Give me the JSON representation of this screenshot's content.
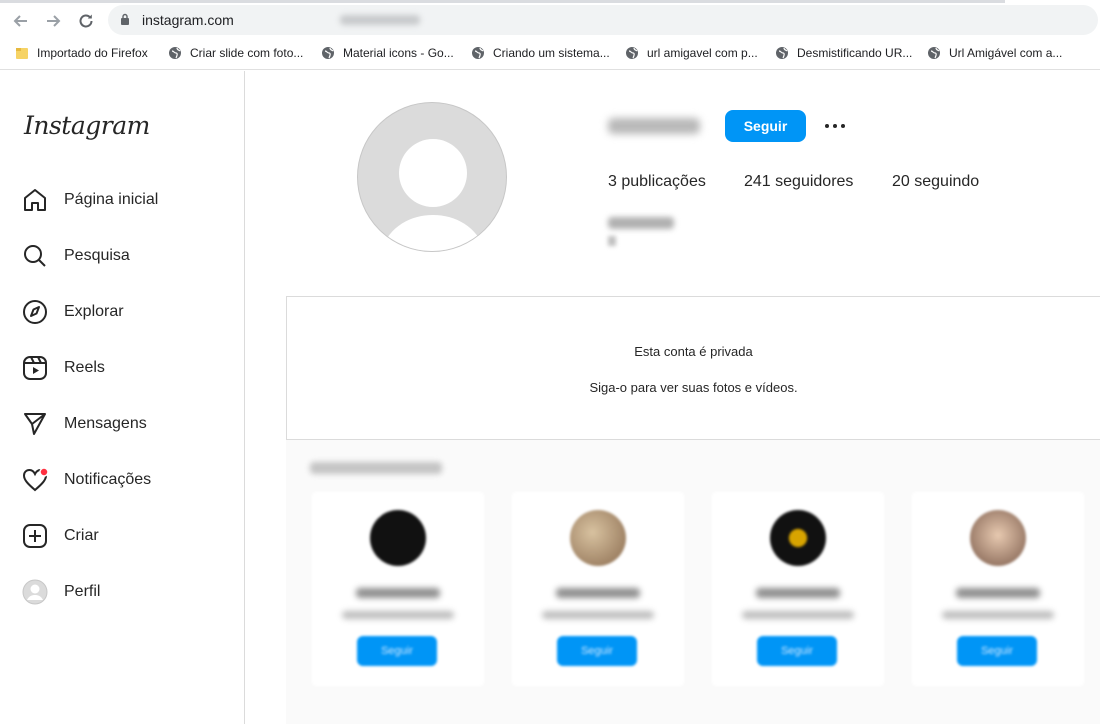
{
  "browser": {
    "url": "instagram.com",
    "bookmarks": [
      {
        "label": "Importado do Firefox",
        "icon": "folder-icon"
      },
      {
        "label": "Criar slide com foto...",
        "icon": "globe-icon"
      },
      {
        "label": "Material icons - Go...",
        "icon": "globe-icon"
      },
      {
        "label": "Criando um sistema...",
        "icon": "globe-icon"
      },
      {
        "label": "url amigavel com p...",
        "icon": "globe-icon"
      },
      {
        "label": "Desmistificando UR...",
        "icon": "globe-icon"
      },
      {
        "label": "Url Amigável com a...",
        "icon": "globe-icon"
      }
    ]
  },
  "sidebar": {
    "logo": "Instagram",
    "items": [
      {
        "label": "Página inicial",
        "icon": "home-icon"
      },
      {
        "label": "Pesquisa",
        "icon": "search-icon"
      },
      {
        "label": "Explorar",
        "icon": "compass-icon"
      },
      {
        "label": "Reels",
        "icon": "reels-icon"
      },
      {
        "label": "Mensagens",
        "icon": "send-icon"
      },
      {
        "label": "Notificações",
        "icon": "heart-icon"
      },
      {
        "label": "Criar",
        "icon": "plus-square-icon"
      },
      {
        "label": "Perfil",
        "icon": "avatar-icon"
      }
    ]
  },
  "profile": {
    "follow_label": "Seguir",
    "posts_count": "3",
    "posts_label": " publicações",
    "followers_count": "241",
    "followers_label": " seguidores",
    "following_count": "20",
    "following_label": " seguindo"
  },
  "private": {
    "title": "Esta conta é privada",
    "subtitle": "Siga-o para ver suas fotos e vídeos."
  },
  "suggestions": {
    "cards": [
      {
        "follow_label": "Seguir"
      },
      {
        "follow_label": "Seguir"
      },
      {
        "follow_label": "Seguir"
      },
      {
        "follow_label": "Seguir"
      }
    ]
  },
  "colors": {
    "accent": "#0095f6",
    "notification_dot": "#ff3040"
  }
}
